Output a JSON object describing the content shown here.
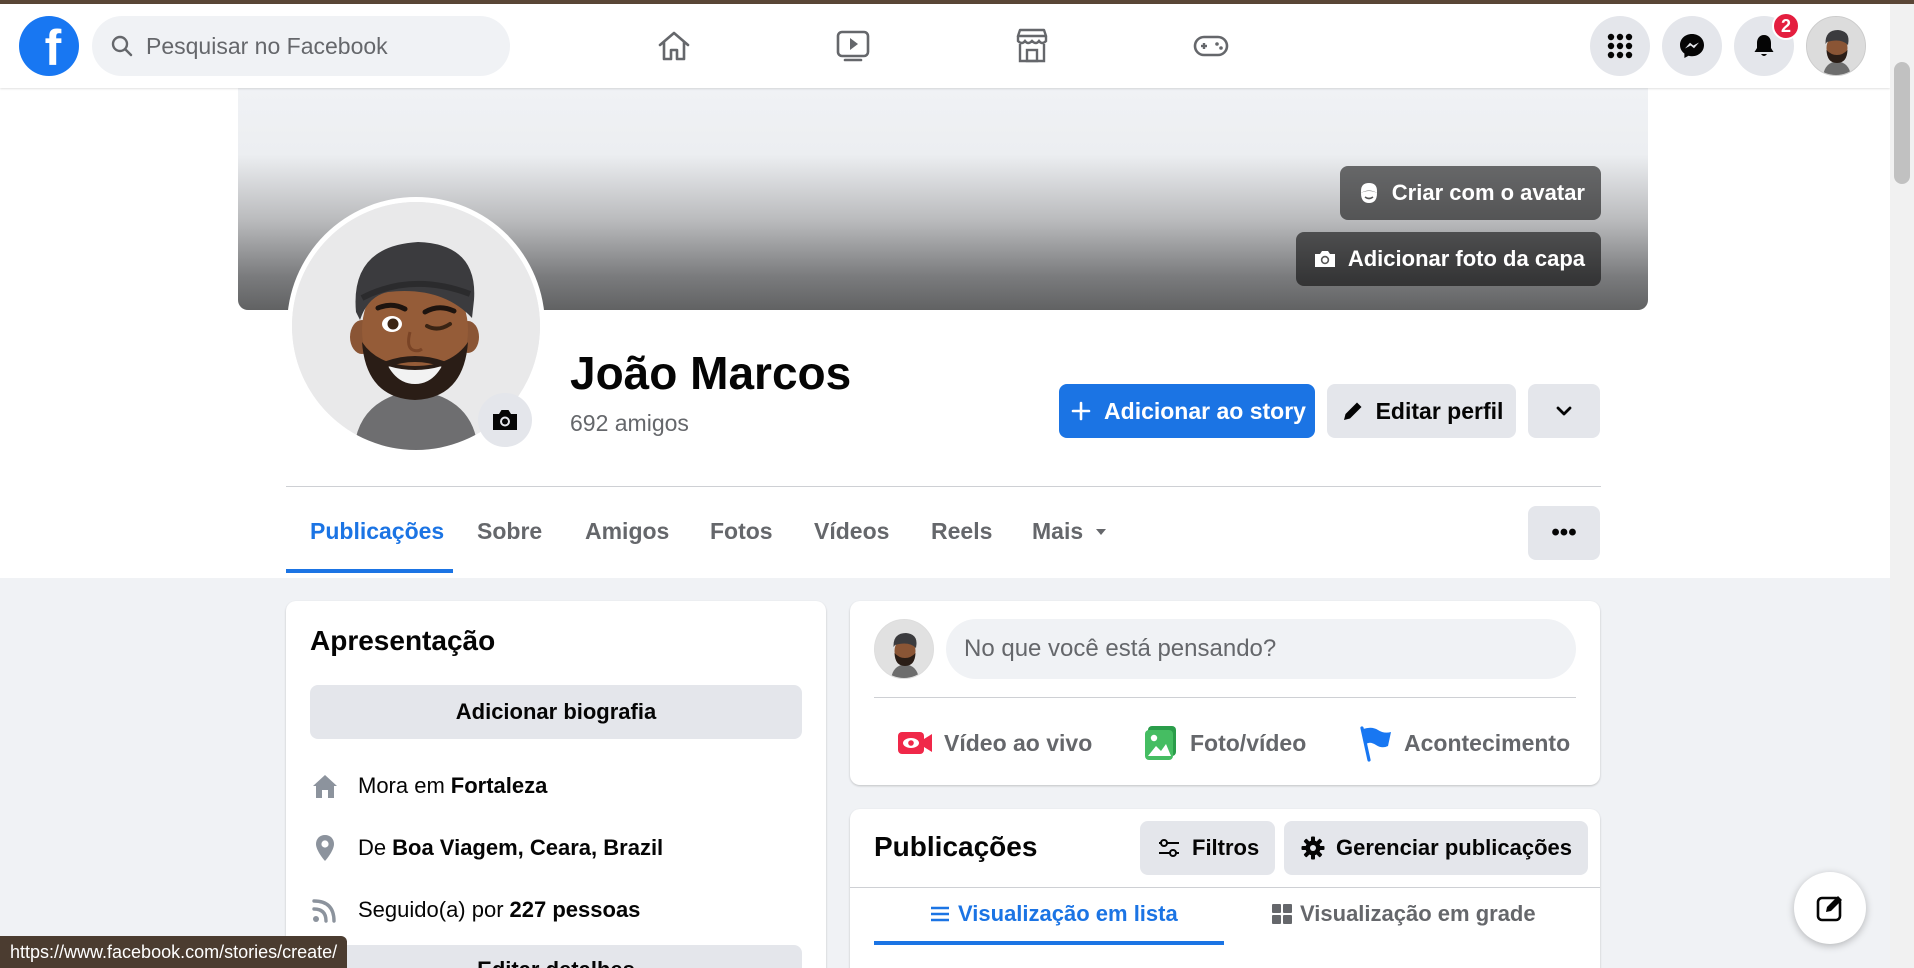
{
  "nav": {
    "logo": "f",
    "search_placeholder": "Pesquisar no Facebook",
    "notifications_count": "2"
  },
  "profile": {
    "name": "João Marcos",
    "friends": "692 amigos",
    "cover_buttons": {
      "avatar": "Criar com o avatar",
      "cover_photo": "Adicionar foto da capa"
    },
    "actions": {
      "add_story": "Adicionar ao story",
      "edit_profile": "Editar perfil"
    },
    "tabs": [
      {
        "label": "Publicações"
      },
      {
        "label": "Sobre"
      },
      {
        "label": "Amigos"
      },
      {
        "label": "Fotos"
      },
      {
        "label": "Vídeos"
      },
      {
        "label": "Reels"
      },
      {
        "label": "Mais"
      }
    ],
    "more_dots": "•••"
  },
  "intro": {
    "title": "Apresentação",
    "add_bio": "Adicionar biografia",
    "lives_prefix": "Mora em",
    "lives_value": "Fortaleza",
    "from_prefix": "De",
    "from_value": "Boa Viagem, Ceara, Brazil",
    "followed_prefix": "Seguido(a) por",
    "followed_value": "227 pessoas",
    "edit_details": "Editar detalhes"
  },
  "composer": {
    "placeholder": "No que você está pensando?",
    "actions": [
      {
        "label": "Vídeo ao vivo",
        "icon": "live-video-icon",
        "color": "#f02849"
      },
      {
        "label": "Foto/vídeo",
        "icon": "photo-icon",
        "color": "#45bd62"
      },
      {
        "label": "Acontecimento",
        "icon": "flag-icon",
        "color": "#1877f2"
      }
    ]
  },
  "posts": {
    "title": "Publicações",
    "filters": "Filtros",
    "manage": "Gerenciar publicações",
    "list_view": "Visualização em lista",
    "grid_view": "Visualização em grade"
  },
  "status": {
    "url": "https://www.facebook.com/stories/create/"
  },
  "colors": {
    "brand": "#1877f2",
    "primary_button": "#1b74e4",
    "badge": "#e41e3f"
  }
}
